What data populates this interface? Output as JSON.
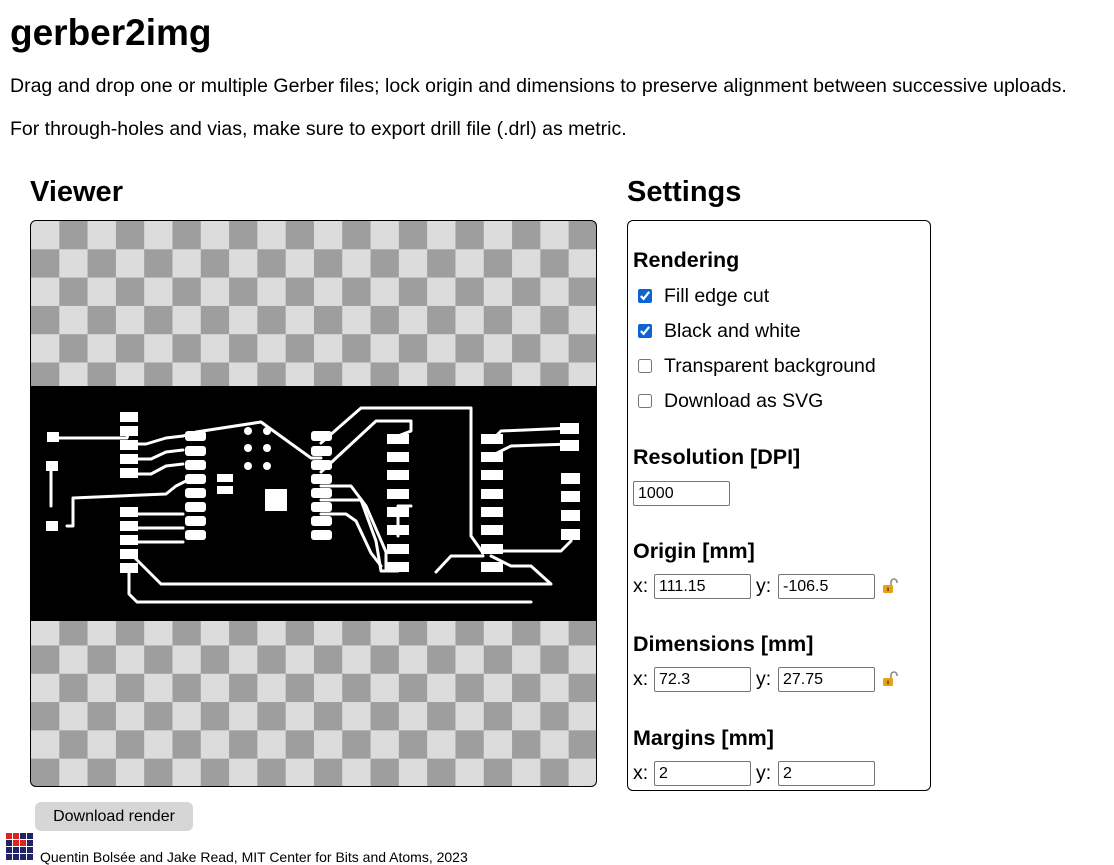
{
  "header": {
    "title": "gerber2img",
    "line1": "Drag and drop one or multiple Gerber files; lock origin and dimensions to preserve alignment between successive uploads.",
    "line2": "For through-holes and vias, make sure to export drill file (.drl) as metric."
  },
  "viewer": {
    "title": "Viewer",
    "download_label": "Download render"
  },
  "settings": {
    "title": "Settings",
    "rendering": {
      "title": "Rendering",
      "options": [
        {
          "label": "Fill edge cut",
          "checked": true
        },
        {
          "label": "Black and white",
          "checked": true
        },
        {
          "label": "Transparent background",
          "checked": false
        },
        {
          "label": "Download as SVG",
          "checked": false
        }
      ]
    },
    "resolution": {
      "title": "Resolution [DPI]",
      "value": "1000"
    },
    "origin": {
      "title": "Origin [mm]",
      "x_label": "x:",
      "y_label": "y:",
      "x": "111.15",
      "y": "-106.5",
      "locked": false
    },
    "dimensions": {
      "title": "Dimensions [mm]",
      "x_label": "x:",
      "y_label": "y:",
      "x": "72.3",
      "y": "27.75",
      "locked": false
    },
    "margins": {
      "title": "Margins [mm]",
      "x_label": "x:",
      "y_label": "y:",
      "x": "2",
      "y": "2"
    }
  },
  "footer": {
    "credit": "Quentin Bolsée and Jake Read, MIT Center for Bits and Atoms, 2023"
  },
  "colors": {
    "accent": "#0b64d2",
    "button_bg": "#d6d6d6",
    "checker_dark": "#9e9e9e",
    "checker_light": "#dcdcdc",
    "lock": "#e3a21a"
  }
}
